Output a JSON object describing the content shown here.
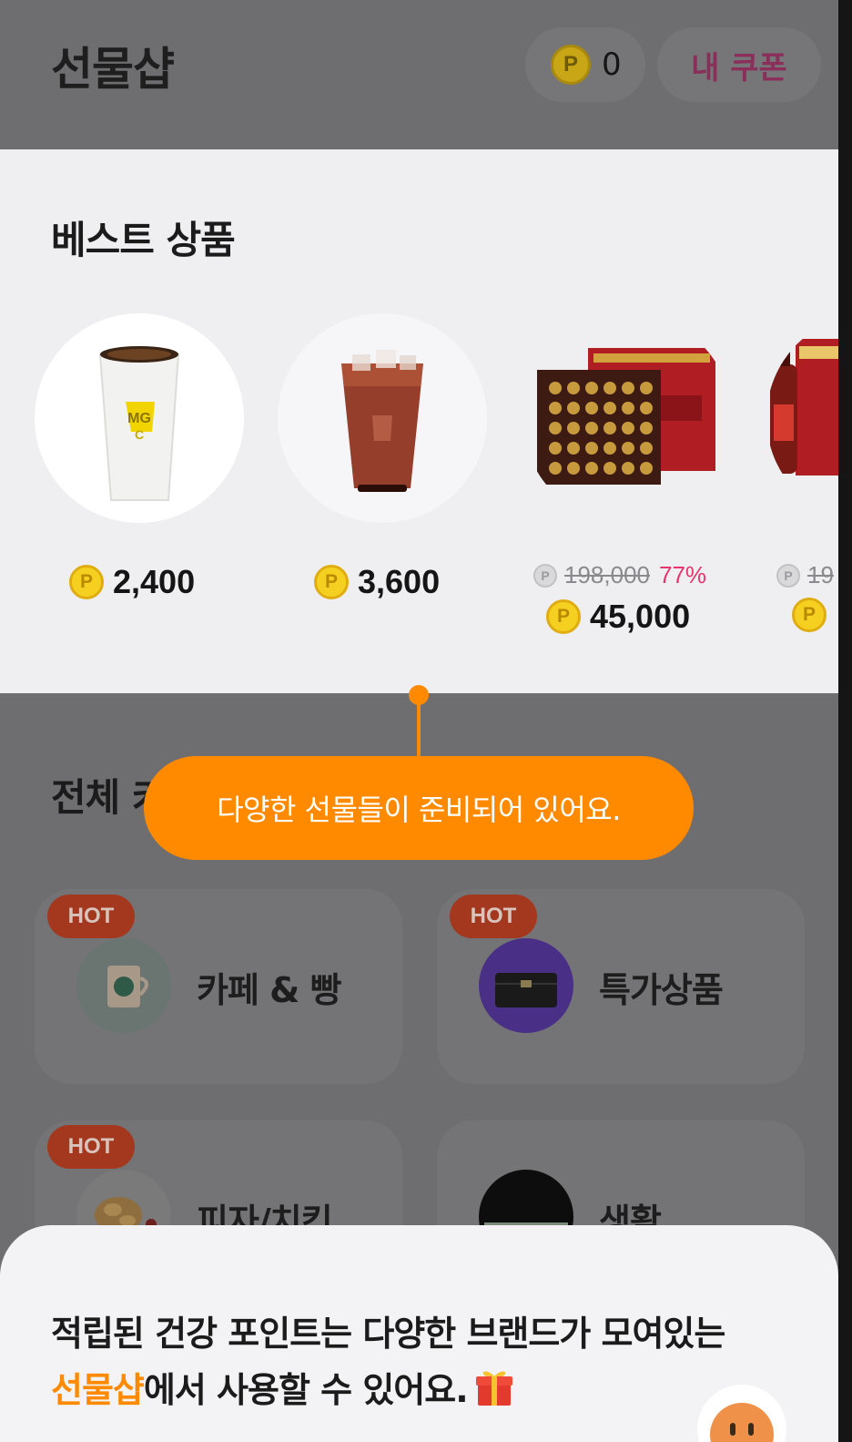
{
  "header": {
    "title": "선물샵",
    "points": "0",
    "coupon_label": "내 쿠폰",
    "coin_symbol": "P"
  },
  "best": {
    "title": "베스트 상품",
    "products": [
      {
        "price": "2,400",
        "image": "mega-coffee-hot-cup"
      },
      {
        "price": "3,600",
        "image": "mega-coffee-iced-americano"
      },
      {
        "original_price": "198,000",
        "discount": "77%",
        "price": "45,000",
        "image": "red-ginseng-gift-box"
      },
      {
        "original_price": "19",
        "image": "premium-red-ginseng-set"
      }
    ]
  },
  "categories": {
    "title": "전체 카",
    "items": [
      {
        "label": "카페 & 빵",
        "hot": "HOT",
        "image": "starbucks-cup"
      },
      {
        "label": "특가상품",
        "hot": "HOT",
        "image": "chanel-bag"
      },
      {
        "label": "피자/치킨",
        "hot": "HOT",
        "image": "fried-chicken"
      },
      {
        "label": "생활",
        "image": "gift-voucher"
      }
    ]
  },
  "tooltip": {
    "text": "다양한 선물들이 준비되어 있어요."
  },
  "sheet": {
    "line1": "적립된 건강 포인트는 다양한 브랜드가 모여있는",
    "highlight": "선물샵",
    "line2_rest": "에서 사용할 수 있어요."
  },
  "colors": {
    "accent": "#ff8a00",
    "discount": "#e8336c",
    "coin": "#f5d020"
  }
}
